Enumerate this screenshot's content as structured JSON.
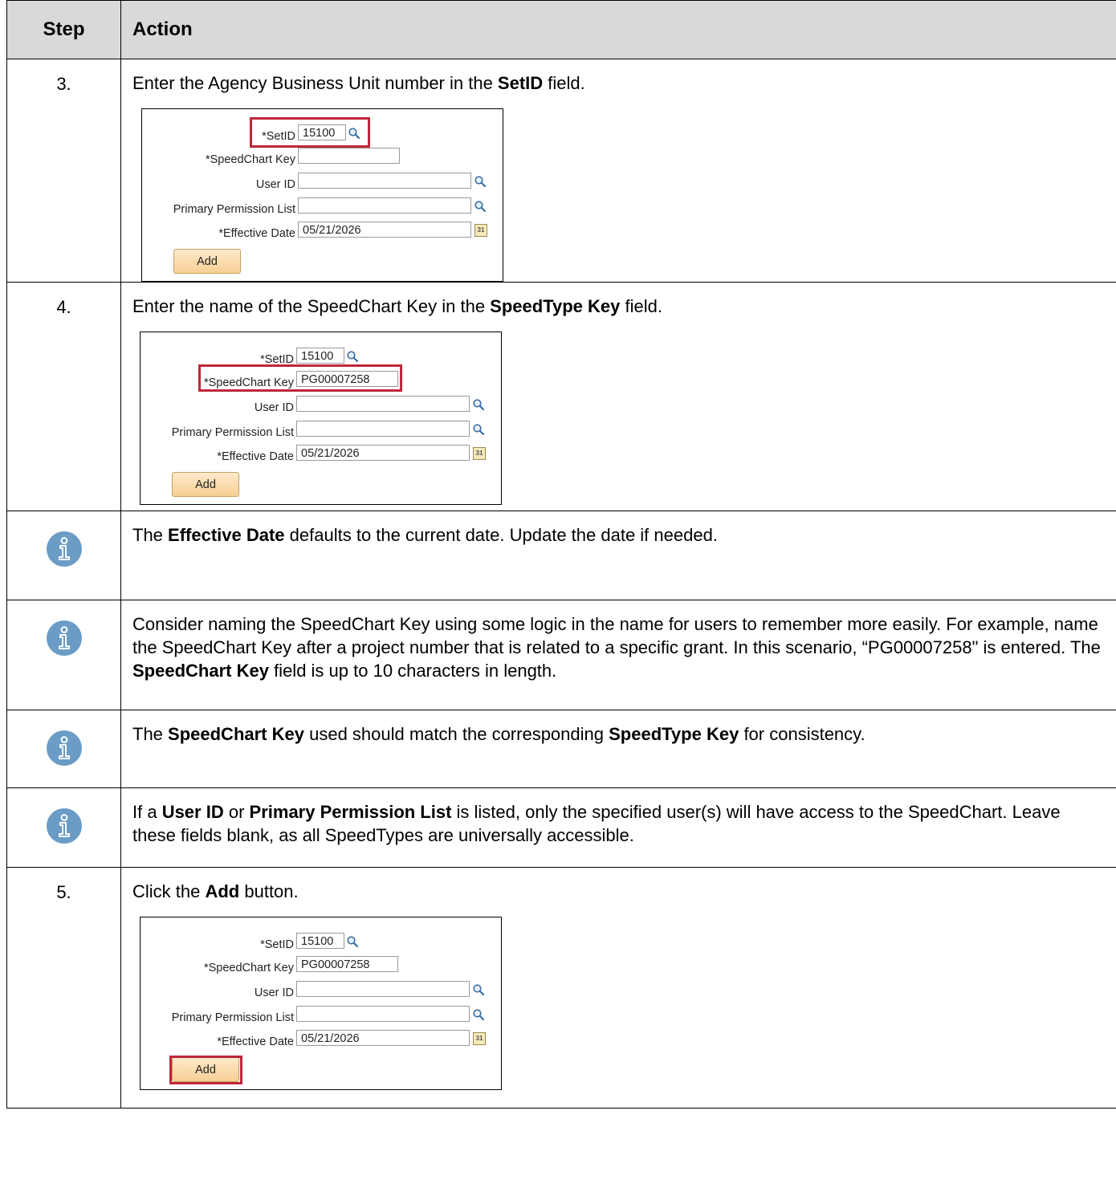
{
  "header": {
    "step": "Step",
    "action": "Action"
  },
  "rows": {
    "r3": {
      "step": "3.",
      "text_a": "Enter the Agency Business Unit number in the ",
      "bold": "SetID",
      "text_b": " field."
    },
    "r4": {
      "step": "4.",
      "text_a": "Enter the name of the SpeedChart Key in the ",
      "bold": "SpeedType Key",
      "text_b": " field."
    },
    "n1": {
      "text_a": "The ",
      "bold": "Effective Date",
      "text_b": " defaults to the current date. Update the date if needed."
    },
    "n2": {
      "text_a": "Consider naming the SpeedChart Key using some logic in the name for users to remember more easily. For example, name the SpeedChart Key after a project number that is related to a specific grant. In this scenario, “PG00007258\" is entered. The ",
      "bold": "SpeedChart Key",
      "text_b": " field is up to 10 characters in length."
    },
    "n3": {
      "text_a": "The ",
      "bold_a": "SpeedChart Key",
      "text_b": " used should match the corresponding ",
      "bold_b": "SpeedType Key",
      "text_c": " for consistency."
    },
    "n4": {
      "text_a": "If a ",
      "bold_a": "User ID",
      "text_b": " or ",
      "bold_b": "Primary Permission List",
      "text_c": " is listed, only the specified user(s) will have access to the SpeedChart. Leave these fields blank, as all SpeedTypes are universally accessible."
    },
    "r5": {
      "step": "5.",
      "text_a": "Click the ",
      "bold": "Add",
      "text_b": " button."
    }
  },
  "form": {
    "labels": {
      "setid": "*SetID",
      "speedchart_key": "*SpeedChart Key",
      "user_id": "User ID",
      "primary_permission_list": "Primary Permission List",
      "effective_date": "*Effective Date",
      "add": "Add"
    },
    "screens": {
      "s1": {
        "setid": "15100",
        "speedchart_key": "",
        "user_id": "",
        "primary_permission_list": "",
        "effective_date": "05/21/2026",
        "highlight": "setid"
      },
      "s2": {
        "setid": "15100",
        "speedchart_key": "PG00007258",
        "user_id": "",
        "primary_permission_list": "",
        "effective_date": "05/21/2026",
        "highlight": "speedchart_key"
      },
      "s3": {
        "setid": "15100",
        "speedchart_key": "PG00007258",
        "user_id": "",
        "primary_permission_list": "",
        "effective_date": "05/21/2026",
        "highlight": "add"
      }
    },
    "calendar_glyph": "31"
  },
  "icons": {
    "info": "info-icon",
    "lookup": "magnifier-icon",
    "calendar": "calendar-icon"
  },
  "colors": {
    "highlight": "#c0263a",
    "info_icon": "#6a9cc6",
    "header_bg": "#d9d9d9",
    "button": "#f6cf95"
  }
}
